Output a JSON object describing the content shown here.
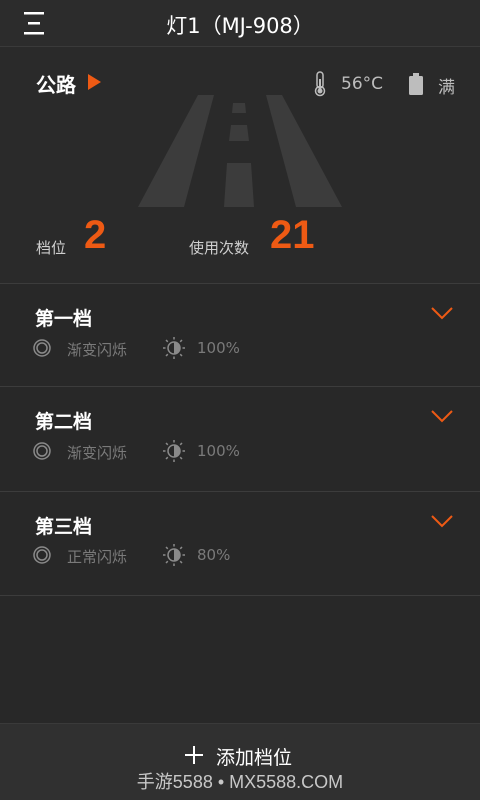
{
  "header": {
    "title": "灯1（MJ-908）",
    "menu_icon": "menu-icon"
  },
  "status": {
    "mode": "公路",
    "temperature": "56°C",
    "battery": "满",
    "gear_label": "档位",
    "gear_value": "2",
    "usage_label": "使用次数",
    "usage_value": "21",
    "accent_color": "#ee5a14"
  },
  "levels": [
    {
      "name": "第一档",
      "mode": "渐变闪烁",
      "brightness": "100%"
    },
    {
      "name": "第二档",
      "mode": "渐变闪烁",
      "brightness": "100%"
    },
    {
      "name": "第三档",
      "mode": "正常闪烁",
      "brightness": "80%"
    }
  ],
  "footer": {
    "add_label": "添加档位",
    "watermark": "手游5588 • MX5588.COM"
  }
}
